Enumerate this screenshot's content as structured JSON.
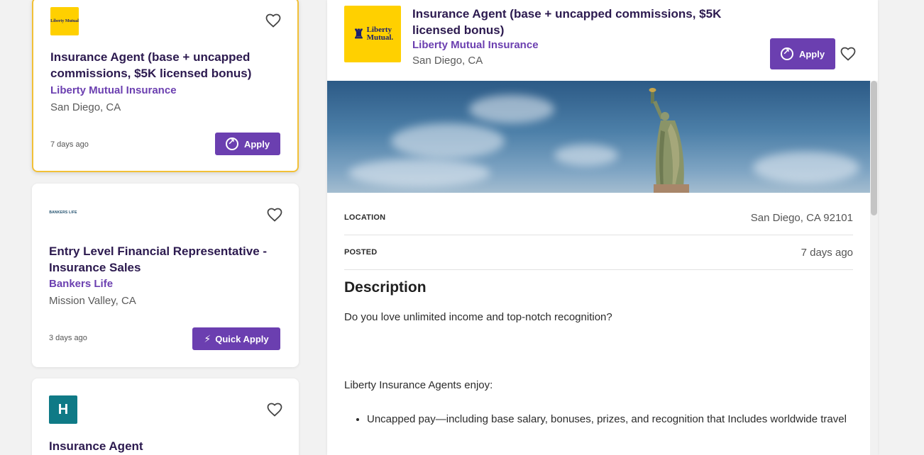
{
  "cards": [
    {
      "logo_text": "Liberty Mutual",
      "title": "Insurance Agent (base + uncapped commissions, $5K licensed bonus)",
      "company": "Liberty Mutual Insurance",
      "location": "San Diego, CA",
      "posted": "7 days ago",
      "apply_label": "Apply"
    },
    {
      "logo_text": "BANKERS LIFE",
      "title": "Entry Level Financial Representative - Insurance Sales",
      "company": "Bankers Life",
      "location": "Mission Valley, CA",
      "posted": "3 days ago",
      "apply_label": "Quick Apply"
    },
    {
      "logo_text": "H",
      "title": "Insurance Agent"
    }
  ],
  "detail": {
    "logo_text": "Liberty Mutual.",
    "title": "Insurance Agent (base + uncapped commissions, $5K licensed bonus)",
    "company": "Liberty Mutual Insurance",
    "location": "San Diego, CA",
    "apply_label": "Apply",
    "fields": [
      {
        "label": "LOCATION",
        "value": "San Diego, CA 92101"
      },
      {
        "label": "POSTED",
        "value": "7 days ago"
      }
    ],
    "description_heading": "Description",
    "description_paragraphs": [
      "Do you love unlimited income and top-notch recognition?",
      "Liberty Insurance Agents enjoy:"
    ],
    "description_bullets": [
      "Uncapped pay—including base salary, bonuses, prizes, and recognition that Includes worldwide travel"
    ]
  },
  "colors": {
    "brand_purple": "#6b3fb0",
    "title_purple": "#2c1a4f",
    "selected_border": "#f2c037",
    "liberty_yellow": "#ffd000"
  }
}
